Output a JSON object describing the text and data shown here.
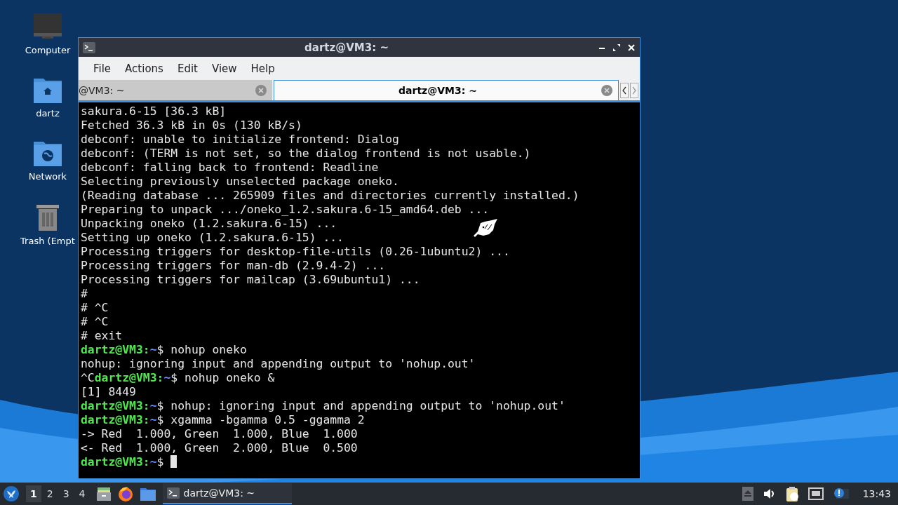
{
  "desktop_icons": [
    {
      "kind": "computer",
      "label": "Computer"
    },
    {
      "kind": "home",
      "label": "dartz"
    },
    {
      "kind": "network",
      "label": "Network"
    },
    {
      "kind": "trash",
      "label": "Trash (Empt"
    }
  ],
  "window": {
    "title": "dartz@VM3: ~"
  },
  "menu": [
    "File",
    "Actions",
    "Edit",
    "View",
    "Help"
  ],
  "tabs": [
    {
      "label": "@VM3: ~",
      "selected": false
    },
    {
      "label": "dartz@VM3: ~",
      "selected": true
    }
  ],
  "terminal": {
    "lines": [
      {
        "kind": "output",
        "text": "sakura.6-15 [36.3 kB]"
      },
      {
        "kind": "output",
        "text": "Fetched 36.3 kB in 0s (130 kB/s)"
      },
      {
        "kind": "output",
        "text": "debconf: unable to initialize frontend: Dialog"
      },
      {
        "kind": "output",
        "text": "debconf: (TERM is not set, so the dialog frontend is not usable.)"
      },
      {
        "kind": "output",
        "text": "debconf: falling back to frontend: Readline"
      },
      {
        "kind": "output",
        "text": "Selecting previously unselected package oneko."
      },
      {
        "kind": "output",
        "text": "(Reading database ... 265909 files and directories currently installed.)"
      },
      {
        "kind": "output",
        "text": "Preparing to unpack .../oneko_1.2.sakura.6-15_amd64.deb ..."
      },
      {
        "kind": "output",
        "text": "Unpacking oneko (1.2.sakura.6-15) ..."
      },
      {
        "kind": "output",
        "text": "Setting up oneko (1.2.sakura.6-15) ..."
      },
      {
        "kind": "output",
        "text": "Processing triggers for desktop-file-utils (0.26-1ubuntu2) ..."
      },
      {
        "kind": "output",
        "text": "Processing triggers for man-db (2.9.4-2) ..."
      },
      {
        "kind": "output",
        "text": "Processing triggers for mailcap (3.69ubuntu1) ..."
      },
      {
        "kind": "output",
        "text": "#"
      },
      {
        "kind": "output",
        "text": "# ^C"
      },
      {
        "kind": "output",
        "text": "# ^C"
      },
      {
        "kind": "output",
        "text": "# exit"
      },
      {
        "kind": "prompt",
        "user": "dartz@VM3:",
        "cwd": "~",
        "cmd": "$ nohup oneko"
      },
      {
        "kind": "output",
        "text": "nohup: ignoring input and appending output to 'nohup.out'"
      },
      {
        "kind": "prompt",
        "pre": "^C",
        "user": "dartz@VM3:",
        "cwd": "~",
        "cmd": "$ nohup oneko &"
      },
      {
        "kind": "output",
        "text": "[1] 8449"
      },
      {
        "kind": "prompt",
        "user": "dartz@VM3:",
        "cwd": "~",
        "cmd": "$ nohup: ignoring input and appending output to 'nohup.out'"
      },
      {
        "kind": "prompt",
        "user": "dartz@VM3:",
        "cwd": "~",
        "cmd": "$ xgamma -bgamma 0.5 -ggamma 2"
      },
      {
        "kind": "output",
        "text": "-> Red  1.000, Green  1.000, Blue  1.000"
      },
      {
        "kind": "output",
        "text": "<- Red  1.000, Green  2.000, Blue  0.500"
      },
      {
        "kind": "prompt",
        "user": "dartz@VM3:",
        "cwd": "~",
        "cmd": "$ ",
        "cursor": true
      }
    ]
  },
  "taskbar": {
    "workspaces": [
      {
        "label": "1",
        "selected": true
      },
      {
        "label": "2",
        "selected": false
      },
      {
        "label": "3",
        "selected": false
      },
      {
        "label": "4",
        "selected": false
      }
    ],
    "task": "dartz@VM3: ~",
    "clock": "13:43"
  }
}
